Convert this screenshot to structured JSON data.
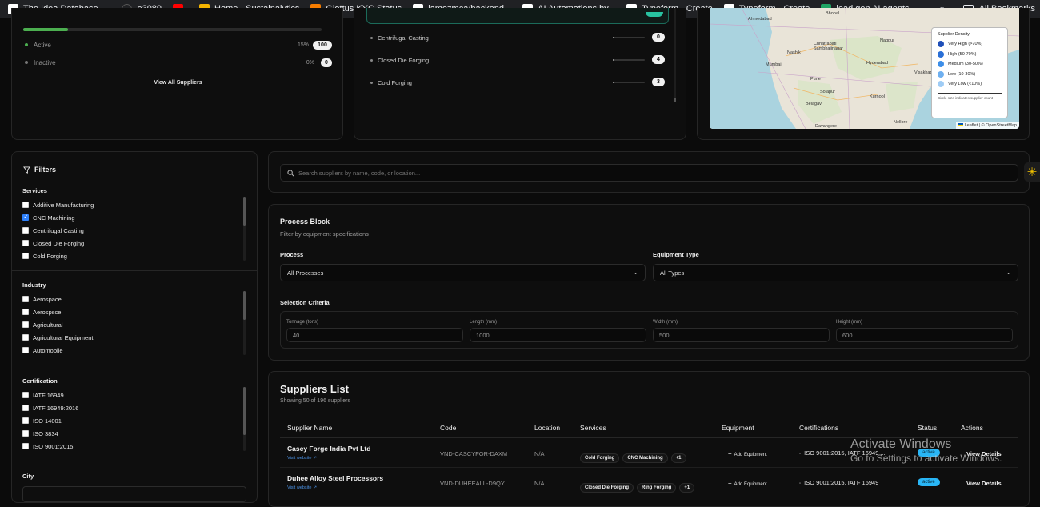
{
  "bookmarks": [
    {
      "label": "The Idea Database -...",
      "icon": "notion-icon",
      "color": "#ffffff"
    },
    {
      "label": "e3080",
      "icon": "globe-icon",
      "color": "#202124"
    },
    {
      "label": "",
      "icon": "youtube-icon",
      "color": "#ff0000"
    },
    {
      "label": "Home - Sustainalytics",
      "icon": "folder-icon",
      "color": "#f4b400"
    },
    {
      "label": "Giottus KYC Status",
      "icon": "giottus-icon",
      "color": "#f57c00"
    },
    {
      "label": "jamezmca/backend...",
      "icon": "github-icon",
      "color": "#ffffff"
    },
    {
      "label": "AI Automations by...",
      "icon": "sk-icon",
      "color": "#ffffff"
    },
    {
      "label": "Typeform - Create",
      "icon": "typeform-icon",
      "color": "#ffffff"
    },
    {
      "label": "Typeform - Create",
      "icon": "typeform-icon",
      "color": "#ffffff"
    },
    {
      "label": "lead gen AI agents -...",
      "icon": "drive-icon",
      "color": "#1fa463"
    }
  ],
  "bookmarks_overflow": "»",
  "all_bookmarks": "All Bookmarks",
  "status_card": {
    "progress_fraction": 0.15,
    "active_label": "Active",
    "active_pct": "15%",
    "active_count": "100",
    "inactive_label": "Inactive",
    "inactive_pct": "0%",
    "inactive_count": "0",
    "view_all": "View All Suppliers"
  },
  "services_card": {
    "items": [
      {
        "label": "Centrifugal Casting",
        "count": "0",
        "fraction": 0.0
      },
      {
        "label": "Closed Die Forging",
        "count": "4",
        "fraction": 0.04
      },
      {
        "label": "Cold Forging",
        "count": "3",
        "fraction": 0.03
      }
    ]
  },
  "map": {
    "cities": [
      "Ahmedabad",
      "Bhopal",
      "Nashik",
      "Chhatrapati Sambhajinagar",
      "Nagpur",
      "Pune",
      "Mumbai",
      "Hyderabad",
      "Visakhapatnam",
      "Solapur",
      "Belagavi",
      "Kurnool",
      "Davangere",
      "Nellore"
    ],
    "legend_title": "Supplier Density",
    "legend": [
      {
        "label": "Very High (>70%)",
        "color": "#1f4fb8"
      },
      {
        "label": "High (50-70%)",
        "color": "#2a6fd6"
      },
      {
        "label": "Medium (30-50%)",
        "color": "#3d8ee8"
      },
      {
        "label": "Low (10-30%)",
        "color": "#6fb0f0"
      },
      {
        "label": "Very Low (<10%)",
        "color": "#9fccf5"
      }
    ],
    "legend_note": "Circle size indicates supplier count",
    "attribution": "Leaflet | © OpenStreetMap"
  },
  "filters": {
    "title": "Filters",
    "groups": [
      {
        "title": "Services",
        "items": [
          {
            "label": "Additive Manufacturing",
            "checked": false
          },
          {
            "label": "CNC Machining",
            "checked": true
          },
          {
            "label": "Centrifugal Casting",
            "checked": false
          },
          {
            "label": "Closed Die Forging",
            "checked": false
          },
          {
            "label": "Cold Forging",
            "checked": false
          }
        ]
      },
      {
        "title": "Industry",
        "items": [
          {
            "label": "Aerospace",
            "checked": false
          },
          {
            "label": "Aerospsce",
            "checked": false
          },
          {
            "label": "Agricultural",
            "checked": false
          },
          {
            "label": "Agricultural Equipment",
            "checked": false
          },
          {
            "label": "Automobile",
            "checked": false
          }
        ]
      },
      {
        "title": "Certification",
        "items": [
          {
            "label": "IATF 16949",
            "checked": false
          },
          {
            "label": "IATF 16949:2016",
            "checked": false
          },
          {
            "label": "ISO 14001",
            "checked": false
          },
          {
            "label": "ISO 3834",
            "checked": false
          },
          {
            "label": "ISO 9001:2015",
            "checked": false
          }
        ]
      }
    ],
    "city_title": "City"
  },
  "search": {
    "placeholder": "Search suppliers by name, code, or location..."
  },
  "process_block": {
    "title": "Process Block",
    "subtitle": "Filter by equipment specifications",
    "process_label": "Process",
    "process_value": "All Processes",
    "equipment_label": "Equipment Type",
    "equipment_value": "All Types",
    "criteria_title": "Selection Criteria",
    "criteria": [
      {
        "label": "Tonnage (tons)",
        "value": "40"
      },
      {
        "label": "Length (mm)",
        "value": "1000"
      },
      {
        "label": "Width (mm)",
        "value": "500"
      },
      {
        "label": "Height (mm)",
        "value": "600"
      }
    ]
  },
  "suppliers": {
    "title": "Suppliers List",
    "subtitle": "Showing 50 of 196 suppliers",
    "columns": [
      "Supplier Name",
      "Code",
      "Location",
      "Services",
      "Equipment",
      "Certifications",
      "Status",
      "Actions"
    ],
    "rows": [
      {
        "name": "Cascy Forge India Pvt Ltd",
        "visit": "Visit website",
        "code": "VND-CASCYFOR-DAXM",
        "location": "N/A",
        "services": [
          "Cold Forging",
          "CNC Machining",
          "+1"
        ],
        "equipment": "Add Equipment",
        "certs": "ISO 9001:2015, IATF 16949 ...",
        "status": "active",
        "action": "View Details"
      },
      {
        "name": "Duhee Alloy Steel Processors",
        "visit": "Visit website",
        "code": "VND-DUHEEALL-D9QY",
        "location": "N/A",
        "services": [
          "Closed Die Forging",
          "Ring Forging",
          "+1"
        ],
        "equipment": "Add Equipment",
        "certs": "ISO 9001:2015, IATF 16949",
        "status": "active",
        "action": "View Details"
      }
    ]
  },
  "watermark": {
    "line1": "Activate Windows",
    "line2": "Go to Settings to activate Windows."
  }
}
